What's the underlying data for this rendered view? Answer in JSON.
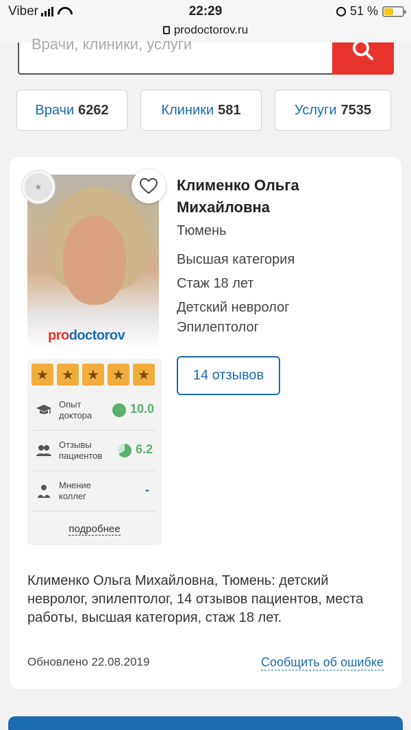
{
  "status_bar": {
    "carrier": "Viber",
    "time": "22:29",
    "battery": "51 %",
    "url": "prodoctorov.ru"
  },
  "search": {
    "placeholder": "Врачи, клиники, услуги"
  },
  "chips": [
    {
      "label": "Врачи",
      "count": "6262"
    },
    {
      "label": "Клиники",
      "count": "581"
    },
    {
      "label": "Услуги",
      "count": "7535"
    }
  ],
  "doctor": {
    "name_line1": "Клименко Ольга",
    "name_line2": "Михайловна",
    "city": "Тюмень",
    "category": "Высшая категория",
    "experience": "Стаж 18 лет",
    "specialty1": "Детский невролог",
    "specialty2": "Эпилептолог",
    "reviews_button": "14 отзывов",
    "photo_logo_pro": "pro",
    "photo_logo_doctorov": "doctorov"
  },
  "rating": {
    "stars": 5,
    "metrics": [
      {
        "label_line1": "Опыт",
        "label_line2": "доктора",
        "value": "10.0"
      },
      {
        "label_line1": "Отзывы",
        "label_line2": "пациентов",
        "value": "6.2"
      },
      {
        "label_line1": "Мнение",
        "label_line2": "коллег",
        "value": "-"
      }
    ],
    "more_link": "подробнее"
  },
  "description": "Клименко Ольга Михайловна, Тюмень: детский невролог, эпилептолог, 14 отзывов пациентов, места работы, высшая категория, стаж 18 лет.",
  "updated": "Обновлено 22.08.2019",
  "report_link": "Сообщить об ошибке",
  "colors": {
    "accent_blue": "#1a6bb0",
    "search_red": "#e8332c",
    "star_orange": "#f0ad3c",
    "rating_green": "#5ab26d"
  }
}
